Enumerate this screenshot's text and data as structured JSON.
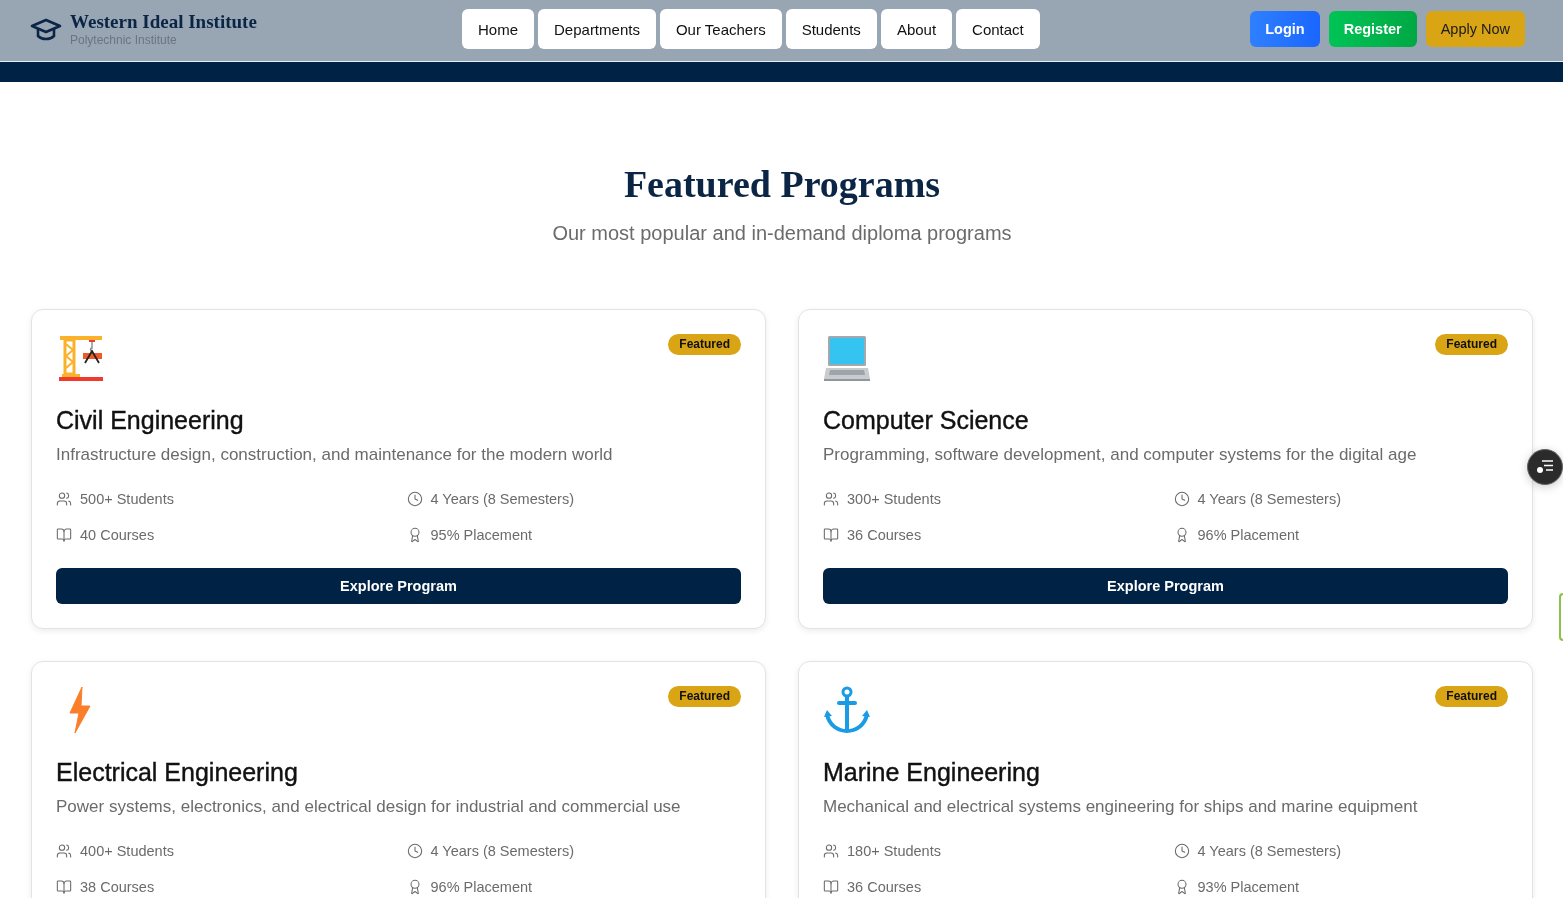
{
  "header": {
    "logo": {
      "title": "Western Ideal Institute",
      "subtitle": "Polytechnic Institute"
    },
    "nav": [
      "Home",
      "Departments",
      "Our Teachers",
      "Students",
      "About",
      "Contact"
    ],
    "actions": [
      {
        "label": "Login",
        "kind": "primary"
      },
      {
        "label": "Register",
        "kind": "success"
      },
      {
        "label": "Apply Now",
        "kind": "accent"
      }
    ]
  },
  "section": {
    "title": "Featured Programs",
    "subtitle": "Our most popular and in-demand diploma programs"
  },
  "programs": [
    {
      "badge": "Featured",
      "name": "Civil Engineering",
      "description": "Infrastructure design, construction, and maintenance for the modern world",
      "stats": [
        {
          "kind": "students",
          "text": "500+ Students"
        },
        {
          "kind": "duration",
          "text": "4 Years (8 Semesters)"
        },
        {
          "kind": "courses",
          "text": "40 Courses"
        },
        {
          "kind": "placement",
          "text": "95% Placement"
        }
      ],
      "button": "Explore Program"
    },
    {
      "badge": "Featured",
      "name": "Computer Science",
      "description": "Programming, software development, and computer systems for the digital age",
      "stats": [
        {
          "kind": "students",
          "text": "300+ Students"
        },
        {
          "kind": "duration",
          "text": "4 Years (8 Semesters)"
        },
        {
          "kind": "courses",
          "text": "36 Courses"
        },
        {
          "kind": "placement",
          "text": "96% Placement"
        }
      ],
      "button": "Explore Program"
    },
    {
      "badge": "Featured",
      "name": "Electrical Engineering",
      "description": "Power systems, electronics, and electrical design for industrial and commercial use",
      "stats": [
        {
          "kind": "students",
          "text": "400+ Students"
        },
        {
          "kind": "duration",
          "text": "4 Years (8 Semesters)"
        },
        {
          "kind": "courses",
          "text": "38 Courses"
        },
        {
          "kind": "placement",
          "text": "96% Placement"
        }
      ]
    },
    {
      "badge": "Featured",
      "name": "Marine Engineering",
      "description": "Mechanical and electrical systems engineering for ships and marine equipment",
      "stats": [
        {
          "kind": "students",
          "text": "180+ Students"
        },
        {
          "kind": "duration",
          "text": "4 Years (8 Semesters)"
        },
        {
          "kind": "courses",
          "text": "36 Courses"
        },
        {
          "kind": "placement",
          "text": "93% Placement"
        }
      ]
    }
  ]
}
